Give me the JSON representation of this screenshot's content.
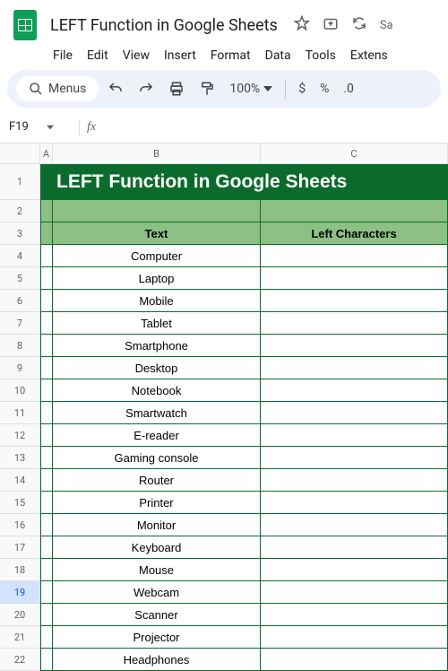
{
  "doc_title": "LEFT Function in Google Sheets",
  "menus": [
    "File",
    "Edit",
    "View",
    "Insert",
    "Format",
    "Data",
    "Tools",
    "Extens"
  ],
  "toolbar": {
    "search_label": "Menus",
    "zoom": "100%",
    "currency": "$",
    "percent": "%",
    "decimal_dec": ".0"
  },
  "name_box": "F19",
  "formula_bar": "",
  "columns": [
    "A",
    "B",
    "C"
  ],
  "banner": "LEFT Function in Google Sheets",
  "headers": {
    "b": "Text",
    "c": "Left Characters"
  },
  "rows": [
    {
      "n": 4,
      "b": "Computer",
      "c": ""
    },
    {
      "n": 5,
      "b": "Laptop",
      "c": ""
    },
    {
      "n": 6,
      "b": "Mobile",
      "c": ""
    },
    {
      "n": 7,
      "b": "Tablet",
      "c": ""
    },
    {
      "n": 8,
      "b": "Smartphone",
      "c": ""
    },
    {
      "n": 9,
      "b": "Desktop",
      "c": ""
    },
    {
      "n": 10,
      "b": "Notebook",
      "c": ""
    },
    {
      "n": 11,
      "b": "Smartwatch",
      "c": ""
    },
    {
      "n": 12,
      "b": "E-reader",
      "c": ""
    },
    {
      "n": 13,
      "b": "Gaming console",
      "c": ""
    },
    {
      "n": 14,
      "b": "Router",
      "c": ""
    },
    {
      "n": 15,
      "b": "Printer",
      "c": ""
    },
    {
      "n": 16,
      "b": "Monitor",
      "c": ""
    },
    {
      "n": 17,
      "b": "Keyboard",
      "c": ""
    },
    {
      "n": 18,
      "b": "Mouse",
      "c": ""
    },
    {
      "n": 19,
      "b": "Webcam",
      "c": ""
    },
    {
      "n": 20,
      "b": "Scanner",
      "c": ""
    },
    {
      "n": 21,
      "b": "Projector",
      "c": ""
    },
    {
      "n": 22,
      "b": "Headphones",
      "c": ""
    }
  ],
  "selected_row": 19,
  "title_icons": {
    "star_label": "Sa"
  },
  "chart_data": {
    "type": "table",
    "title": "LEFT Function in Google Sheets",
    "columns": [
      "Text",
      "Left Characters"
    ],
    "data": [
      [
        "Computer",
        ""
      ],
      [
        "Laptop",
        ""
      ],
      [
        "Mobile",
        ""
      ],
      [
        "Tablet",
        ""
      ],
      [
        "Smartphone",
        ""
      ],
      [
        "Desktop",
        ""
      ],
      [
        "Notebook",
        ""
      ],
      [
        "Smartwatch",
        ""
      ],
      [
        "E-reader",
        ""
      ],
      [
        "Gaming console",
        ""
      ],
      [
        "Router",
        ""
      ],
      [
        "Printer",
        ""
      ],
      [
        "Monitor",
        ""
      ],
      [
        "Keyboard",
        ""
      ],
      [
        "Mouse",
        ""
      ],
      [
        "Webcam",
        ""
      ],
      [
        "Scanner",
        ""
      ],
      [
        "Projector",
        ""
      ],
      [
        "Headphones",
        ""
      ]
    ]
  }
}
